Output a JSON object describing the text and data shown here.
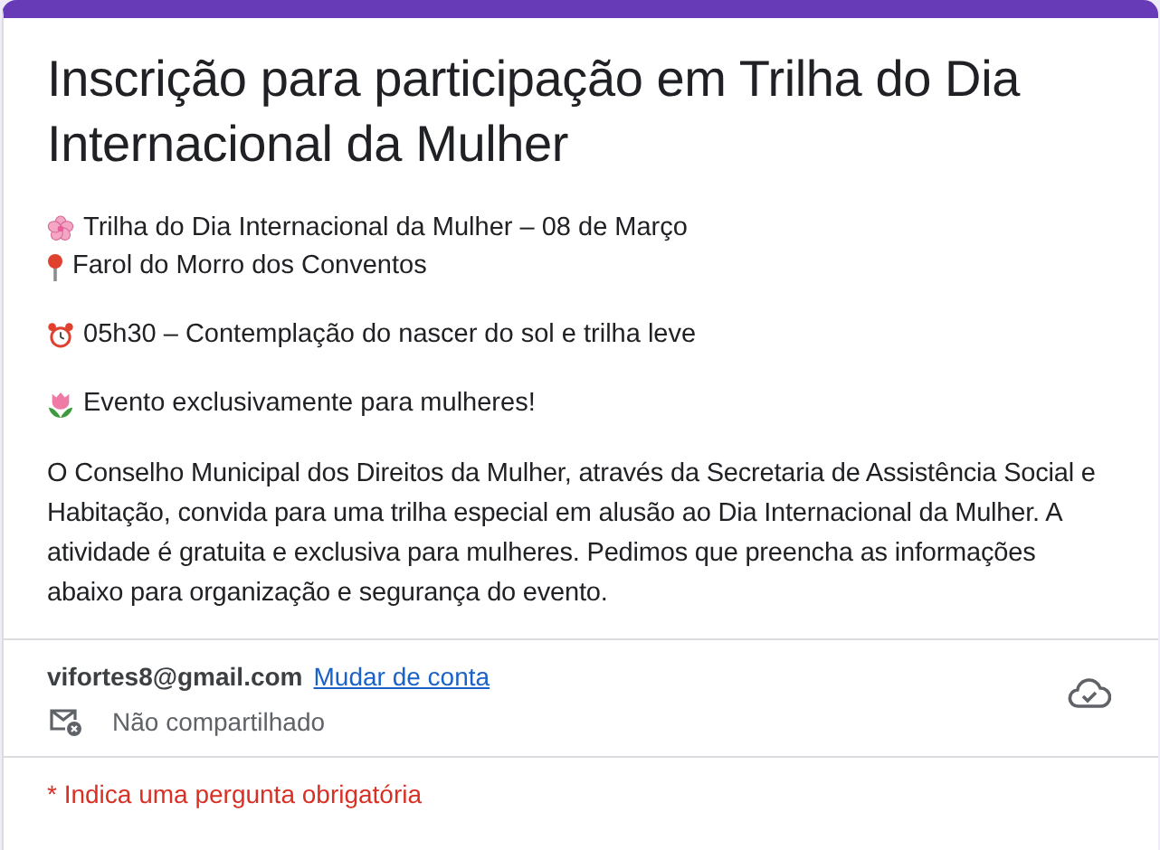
{
  "form": {
    "title": "Inscrição para participação em Trilha do Dia Internacional da Mulher",
    "description_blocks": [
      [
        {
          "kind": "flower",
          "text": "Trilha do Dia Internacional da Mulher – 08 de Março"
        },
        {
          "kind": "pin",
          "text": "Farol do Morro dos Conventos"
        }
      ],
      [
        {
          "kind": "clock",
          "text": "05h30 – Contemplação do nascer do sol e trilha leve"
        }
      ],
      [
        {
          "kind": "tulip",
          "text": "Evento exclusivamente para mulheres!"
        }
      ]
    ],
    "description_paragraph": "O Conselho Municipal dos Direitos da Mulher, através da Secretaria de Assistência Social e Habitação, convida para uma trilha especial em alusão ao Dia Internacional da Mulher. A atividade é gratuita e exclusiva para mulheres. Pedimos que preencha as informações abaixo para organização e segurança do evento."
  },
  "account": {
    "email": "vifortes8@gmail.com",
    "switch_link": "Mudar de conta",
    "sharing_status": "Não compartilhado"
  },
  "required_note": "* Indica uma pergunta obrigatória"
}
